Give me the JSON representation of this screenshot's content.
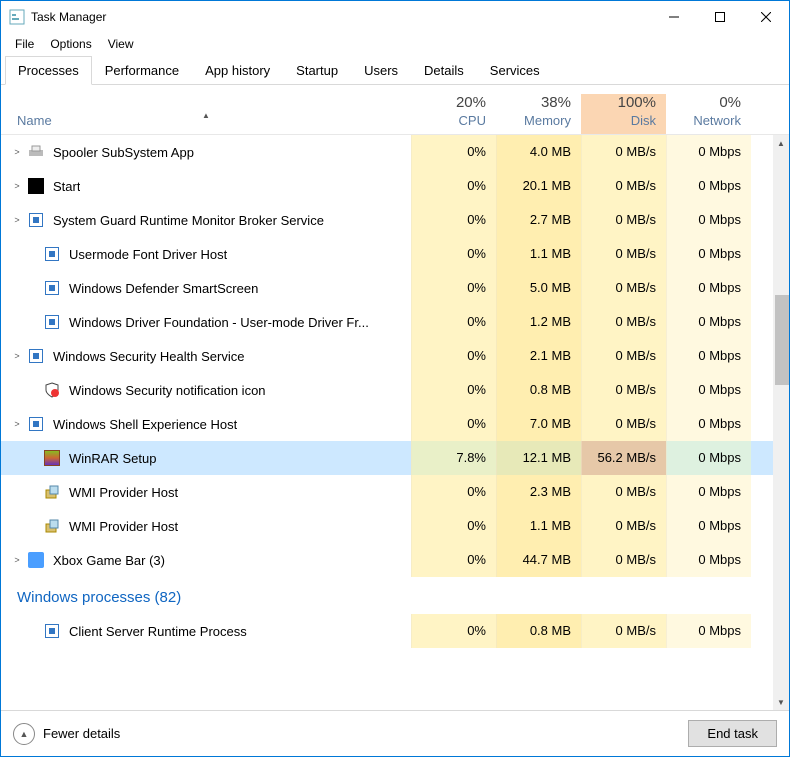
{
  "title": "Task Manager",
  "menubar": [
    "File",
    "Options",
    "View"
  ],
  "tabs": [
    "Processes",
    "Performance",
    "App history",
    "Startup",
    "Users",
    "Details",
    "Services"
  ],
  "active_tab": 0,
  "columns": {
    "name": "Name",
    "cpu": {
      "percent": "20%",
      "label": "CPU"
    },
    "memory": {
      "percent": "38%",
      "label": "Memory"
    },
    "disk": {
      "percent": "100%",
      "label": "Disk"
    },
    "network": {
      "percent": "0%",
      "label": "Network"
    }
  },
  "rows": [
    {
      "expandable": true,
      "indent": 0,
      "icon": "printer",
      "name": "Spooler SubSystem App",
      "cpu": "0%",
      "mem": "4.0 MB",
      "disk": "0 MB/s",
      "net": "0 Mbps"
    },
    {
      "expandable": true,
      "indent": 0,
      "icon": "start",
      "name": "Start",
      "cpu": "0%",
      "mem": "20.1 MB",
      "disk": "0 MB/s",
      "net": "0 Mbps"
    },
    {
      "expandable": true,
      "indent": 0,
      "icon": "app",
      "name": "System Guard Runtime Monitor Broker Service",
      "cpu": "0%",
      "mem": "2.7 MB",
      "disk": "0 MB/s",
      "net": "0 Mbps"
    },
    {
      "expandable": false,
      "indent": 1,
      "icon": "app",
      "name": "Usermode Font Driver Host",
      "cpu": "0%",
      "mem": "1.1 MB",
      "disk": "0 MB/s",
      "net": "0 Mbps"
    },
    {
      "expandable": false,
      "indent": 1,
      "icon": "app",
      "name": "Windows Defender SmartScreen",
      "cpu": "0%",
      "mem": "5.0 MB",
      "disk": "0 MB/s",
      "net": "0 Mbps"
    },
    {
      "expandable": false,
      "indent": 1,
      "icon": "app",
      "name": "Windows Driver Foundation - User-mode Driver Fr...",
      "cpu": "0%",
      "mem": "1.2 MB",
      "disk": "0 MB/s",
      "net": "0 Mbps"
    },
    {
      "expandable": true,
      "indent": 0,
      "icon": "app",
      "name": "Windows Security Health Service",
      "cpu": "0%",
      "mem": "2.1 MB",
      "disk": "0 MB/s",
      "net": "0 Mbps"
    },
    {
      "expandable": false,
      "indent": 1,
      "icon": "shield",
      "name": "Windows Security notification icon",
      "cpu": "0%",
      "mem": "0.8 MB",
      "disk": "0 MB/s",
      "net": "0 Mbps"
    },
    {
      "expandable": true,
      "indent": 0,
      "icon": "app",
      "name": "Windows Shell Experience Host",
      "cpu": "0%",
      "mem": "7.0 MB",
      "disk": "0 MB/s",
      "net": "0 Mbps"
    },
    {
      "expandable": false,
      "indent": 1,
      "icon": "winrar",
      "name": "WinRAR Setup",
      "cpu": "7.8%",
      "mem": "12.1 MB",
      "disk": "56.2 MB/s",
      "net": "0 Mbps",
      "selected": true
    },
    {
      "expandable": false,
      "indent": 1,
      "icon": "wmi",
      "name": "WMI Provider Host",
      "cpu": "0%",
      "mem": "2.3 MB",
      "disk": "0 MB/s",
      "net": "0 Mbps"
    },
    {
      "expandable": false,
      "indent": 1,
      "icon": "wmi",
      "name": "WMI Provider Host",
      "cpu": "0%",
      "mem": "1.1 MB",
      "disk": "0 MB/s",
      "net": "0 Mbps"
    },
    {
      "expandable": true,
      "indent": 0,
      "icon": "xbox",
      "name": "Xbox Game Bar (3)",
      "cpu": "0%",
      "mem": "44.7 MB",
      "disk": "0 MB/s",
      "net": "0 Mbps"
    }
  ],
  "group": {
    "label": "Windows processes (82)"
  },
  "group_rows": [
    {
      "expandable": false,
      "indent": 1,
      "icon": "app",
      "name": "Client Server Runtime Process",
      "cpu": "0%",
      "mem": "0.8 MB",
      "disk": "0 MB/s",
      "net": "0 Mbps"
    }
  ],
  "footer": {
    "fewer": "Fewer details",
    "end_task": "End task"
  }
}
